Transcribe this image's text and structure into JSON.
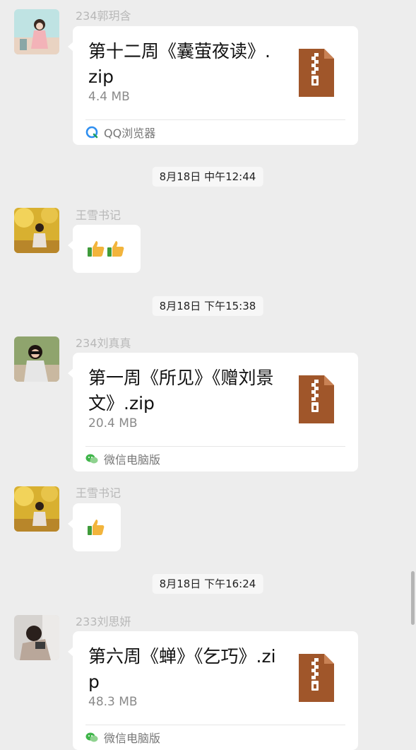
{
  "messages": [
    {
      "sender": "234郭玥含",
      "file_name": "第十二周《囊萤夜读》.zip",
      "file_size": "4.4 MB",
      "source": "QQ浏览器",
      "source_icon": "qq-browser-icon"
    },
    {
      "time": "8月18日 中午12:44"
    },
    {
      "sender": "王雪书记",
      "emoji": "thumbs-up-icon x2"
    },
    {
      "time": "8月18日 下午15:38"
    },
    {
      "sender": "234刘真真",
      "file_name": "第一周《所见》《赠刘景文》.zip",
      "file_size": "20.4 MB",
      "source": "微信电脑版",
      "source_icon": "wechat-pc-icon"
    },
    {
      "sender": "王雪书记",
      "emoji": "thumbs-up-icon x1"
    },
    {
      "time": "8月18日 下午16:24"
    },
    {
      "sender": "233刘思妍",
      "file_name": "第六周《蝉》《乞巧》.zip",
      "file_size": "48.3 MB",
      "source": "微信电脑版",
      "source_icon": "wechat-pc-icon"
    }
  ],
  "colors": {
    "background": "#ededed",
    "bubble": "#ffffff",
    "zip_icon": "#a0562a",
    "sender_text": "#b8b8b8"
  }
}
